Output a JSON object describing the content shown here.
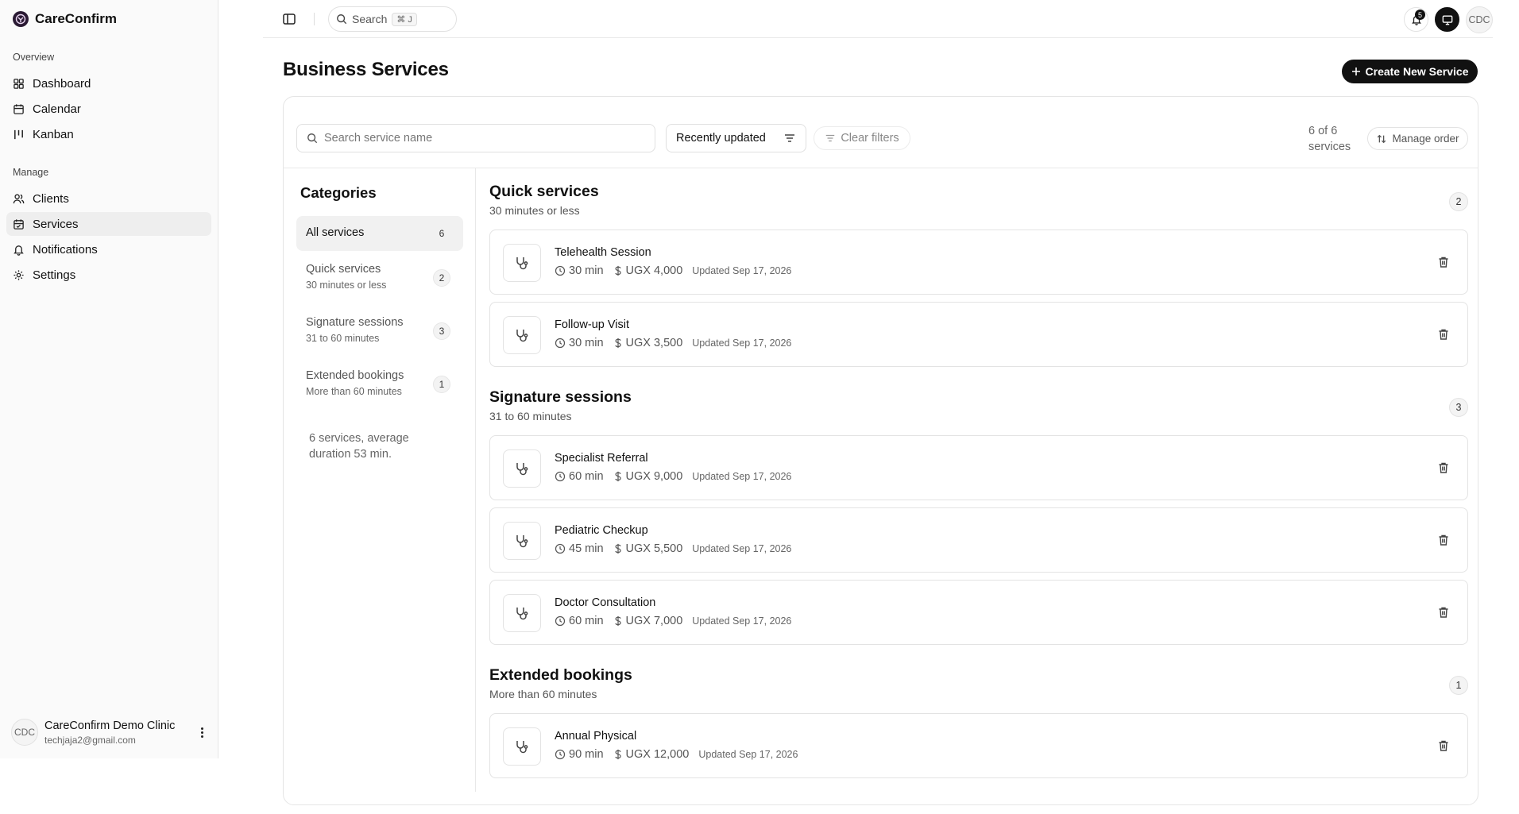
{
  "app": {
    "name": "CareConfirm"
  },
  "sidebar": {
    "groups": [
      {
        "label": "Overview",
        "items": [
          {
            "label": "Dashboard",
            "icon": "dashboard-icon"
          },
          {
            "label": "Calendar",
            "icon": "calendar-icon"
          },
          {
            "label": "Kanban",
            "icon": "kanban-icon"
          }
        ]
      },
      {
        "label": "Manage",
        "items": [
          {
            "label": "Clients",
            "icon": "users-icon"
          },
          {
            "label": "Services",
            "icon": "calendar-check-icon",
            "active": true
          },
          {
            "label": "Notifications",
            "icon": "bell-icon"
          },
          {
            "label": "Settings",
            "icon": "gear-icon"
          }
        ]
      }
    ],
    "user": {
      "initials": "CDC",
      "name": "CareConfirm Demo Clinic",
      "email": "techjaja2@gmail.com"
    }
  },
  "topbar": {
    "search_label": "Search",
    "shortcut": "⌘ J",
    "notification_count": "5",
    "avatar_initials": "CDC"
  },
  "page": {
    "title": "Business Services",
    "create_label": "Create New Service"
  },
  "filters": {
    "search_placeholder": "Search service name",
    "sort_label": "Recently updated",
    "clear_label": "Clear filters",
    "count_line1": "6 of 6",
    "count_line2": "services",
    "manage_label": "Manage order"
  },
  "categories": {
    "title": "Categories",
    "items": [
      {
        "name": "All services",
        "sub": "",
        "count": "6",
        "active": true
      },
      {
        "name": "Quick services",
        "sub": "30 minutes or less",
        "count": "2"
      },
      {
        "name": "Signature sessions",
        "sub": "31 to 60 minutes",
        "count": "3"
      },
      {
        "name": "Extended bookings",
        "sub": "More than 60 minutes",
        "count": "1"
      }
    ],
    "summary": "6 services, average duration 53 min."
  },
  "sections": [
    {
      "title": "Quick services",
      "sub": "30 minutes or less",
      "count": "2",
      "services": [
        {
          "name": "Telehealth Session",
          "duration": "30 min",
          "price": "UGX 4,000",
          "updated": "Updated Sep 17, 2026"
        },
        {
          "name": "Follow-up Visit",
          "duration": "30 min",
          "price": "UGX 3,500",
          "updated": "Updated Sep 17, 2026"
        }
      ]
    },
    {
      "title": "Signature sessions",
      "sub": "31 to 60 minutes",
      "count": "3",
      "services": [
        {
          "name": "Specialist Referral",
          "duration": "60 min",
          "price": "UGX 9,000",
          "updated": "Updated Sep 17, 2026"
        },
        {
          "name": "Pediatric Checkup",
          "duration": "45 min",
          "price": "UGX 5,500",
          "updated": "Updated Sep 17, 2026"
        },
        {
          "name": "Doctor Consultation",
          "duration": "60 min",
          "price": "UGX 7,000",
          "updated": "Updated Sep 17, 2026"
        }
      ]
    },
    {
      "title": "Extended bookings",
      "sub": "More than 60 minutes",
      "count": "1",
      "services": [
        {
          "name": "Annual Physical",
          "duration": "90 min",
          "price": "UGX 12,000",
          "updated": "Updated Sep 17, 2026"
        }
      ]
    }
  ]
}
